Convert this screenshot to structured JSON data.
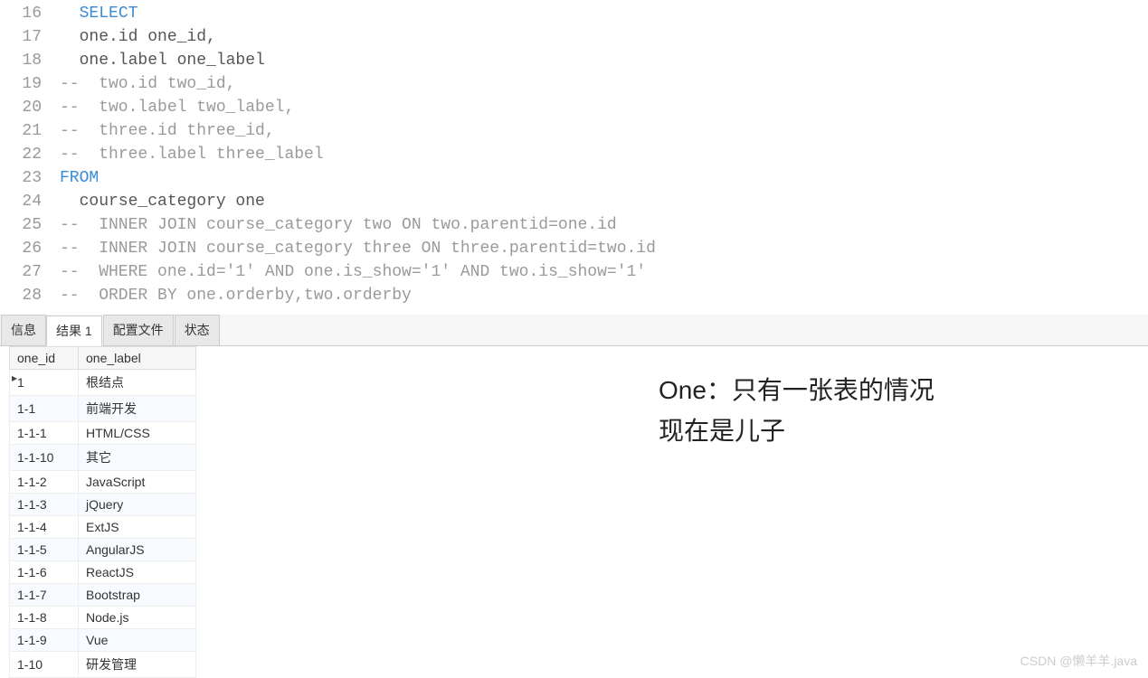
{
  "editor": {
    "lines": [
      {
        "num": 16,
        "segments": [
          {
            "t": "  ",
            "c": "txt"
          },
          {
            "t": "SELECT",
            "c": "kw"
          }
        ]
      },
      {
        "num": 17,
        "segments": [
          {
            "t": "  one.id one_id,",
            "c": "txt"
          }
        ]
      },
      {
        "num": 18,
        "segments": [
          {
            "t": "  one.label one_label",
            "c": "txt"
          }
        ]
      },
      {
        "num": 19,
        "segments": [
          {
            "t": "--  two.id two_id,",
            "c": "com"
          }
        ]
      },
      {
        "num": 20,
        "segments": [
          {
            "t": "--  two.label two_label,",
            "c": "com"
          }
        ]
      },
      {
        "num": 21,
        "segments": [
          {
            "t": "--  three.id three_id,",
            "c": "com"
          }
        ]
      },
      {
        "num": 22,
        "segments": [
          {
            "t": "--  three.label three_label",
            "c": "com"
          }
        ]
      },
      {
        "num": 23,
        "segments": [
          {
            "t": "FROM",
            "c": "kw"
          }
        ]
      },
      {
        "num": 24,
        "segments": [
          {
            "t": "  course_category one",
            "c": "txt"
          }
        ]
      },
      {
        "num": 25,
        "segments": [
          {
            "t": "--  INNER JOIN course_category two ON two.parentid=one.id",
            "c": "com"
          }
        ]
      },
      {
        "num": 26,
        "segments": [
          {
            "t": "--  INNER JOIN course_category three ON three.parentid=two.id",
            "c": "com"
          }
        ]
      },
      {
        "num": 27,
        "segments": [
          {
            "t": "--  WHERE one.id='1' AND one.is_show='1' AND two.is_show='1'",
            "c": "com"
          }
        ]
      },
      {
        "num": 28,
        "segments": [
          {
            "t": "--  ORDER BY one.orderby,two.orderby",
            "c": "com"
          }
        ]
      }
    ]
  },
  "tabs": {
    "items": [
      {
        "label": "信息",
        "active": false
      },
      {
        "label": "结果 1",
        "active": true
      },
      {
        "label": "配置文件",
        "active": false
      },
      {
        "label": "状态",
        "active": false
      }
    ]
  },
  "grid": {
    "columns": [
      "one_id",
      "one_label"
    ],
    "rows": [
      {
        "one_id": "1",
        "one_label": "根结点",
        "current": true
      },
      {
        "one_id": "1-1",
        "one_label": "前端开发"
      },
      {
        "one_id": "1-1-1",
        "one_label": "HTML/CSS"
      },
      {
        "one_id": "1-1-10",
        "one_label": "其它"
      },
      {
        "one_id": "1-1-2",
        "one_label": "JavaScript"
      },
      {
        "one_id": "1-1-3",
        "one_label": "jQuery"
      },
      {
        "one_id": "1-1-4",
        "one_label": "ExtJS"
      },
      {
        "one_id": "1-1-5",
        "one_label": "AngularJS"
      },
      {
        "one_id": "1-1-6",
        "one_label": "ReactJS"
      },
      {
        "one_id": "1-1-7",
        "one_label": "Bootstrap"
      },
      {
        "one_id": "1-1-8",
        "one_label": "Node.js"
      },
      {
        "one_id": "1-1-9",
        "one_label": "Vue"
      },
      {
        "one_id": "1-10",
        "one_label": "研发管理"
      }
    ]
  },
  "annotation": {
    "line1": "One：只有一张表的情况",
    "line2": "现在是儿子"
  },
  "watermark": "CSDN @懒羊羊.java"
}
